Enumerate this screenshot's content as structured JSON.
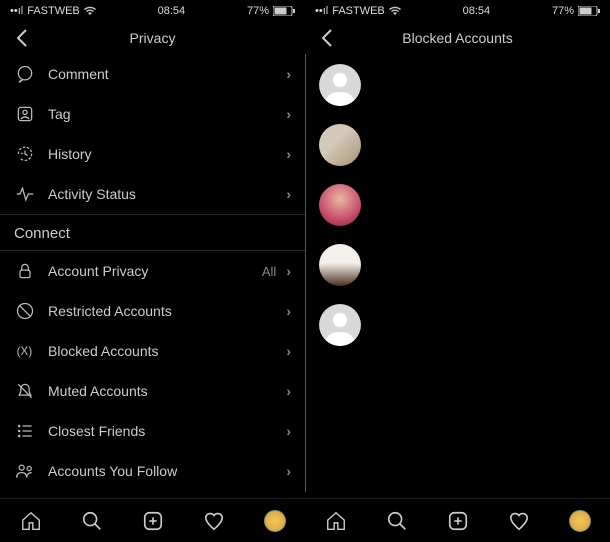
{
  "left": {
    "status": {
      "carrier": "FASTWEB",
      "time": "08:54",
      "battery": "77%"
    },
    "header": {
      "title": "Privacy"
    },
    "items": [
      {
        "icon": "comment-icon",
        "label": "Comment"
      },
      {
        "icon": "tag-icon",
        "label": "Tag"
      },
      {
        "icon": "history-icon",
        "label": "History"
      },
      {
        "icon": "activity-icon",
        "label": "Activity Status"
      }
    ],
    "section_header": "Connect",
    "connect_items": [
      {
        "icon": "lock-icon",
        "label": "Account Privacy",
        "value": "All"
      },
      {
        "icon": "restricted-icon",
        "label": "Restricted Accounts"
      },
      {
        "icon": "blocked-icon",
        "label": "Blocked Accounts"
      },
      {
        "icon": "muted-icon",
        "label": "Muted Accounts"
      },
      {
        "icon": "closest-icon",
        "label": "Closest Friends"
      },
      {
        "icon": "follow-icon",
        "label": "Accounts You Follow"
      }
    ]
  },
  "right": {
    "status": {
      "carrier": "FASTWEB",
      "time": "08:54",
      "battery": "77%"
    },
    "header": {
      "title": "Blocked Accounts"
    },
    "blocked": [
      {
        "type": "placeholder"
      },
      {
        "type": "photo1"
      },
      {
        "type": "photo2"
      },
      {
        "type": "photo3"
      },
      {
        "type": "placeholder"
      }
    ]
  },
  "nav": {
    "items": [
      "home",
      "search",
      "create",
      "activity",
      "profile"
    ]
  }
}
